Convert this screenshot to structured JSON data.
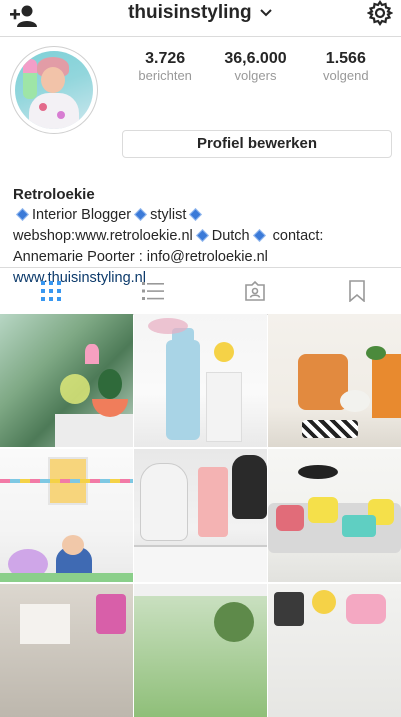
{
  "header": {
    "username": "thuisinstyling",
    "add_user_icon": "add-user-icon",
    "settings_icon": "gear-icon"
  },
  "profile": {
    "stats": [
      {
        "value": "3.726",
        "label": "berichten"
      },
      {
        "value": "36,6.000",
        "label": "volgers"
      },
      {
        "value": "1.566",
        "label": "volgend"
      }
    ],
    "edit_button": "Profiel bewerken",
    "name": "Retroloekie",
    "bio_line1": "Interior Blogger",
    "bio_line1b": "stylist",
    "bio_line2a": "webshop:www.retroloekie.nl",
    "bio_line2b": "Dutch",
    "bio_line2c": "contact:",
    "bio_line3": "Annemarie Poorter : info@retroloekie.nl",
    "website": "www.thuisinstyling.nl"
  },
  "tabs": [
    "grid-icon",
    "list-icon",
    "tagged-icon",
    "bookmark-icon"
  ],
  "colors": {
    "link": "#0c3a6b",
    "accent": "#3b7ad8"
  }
}
